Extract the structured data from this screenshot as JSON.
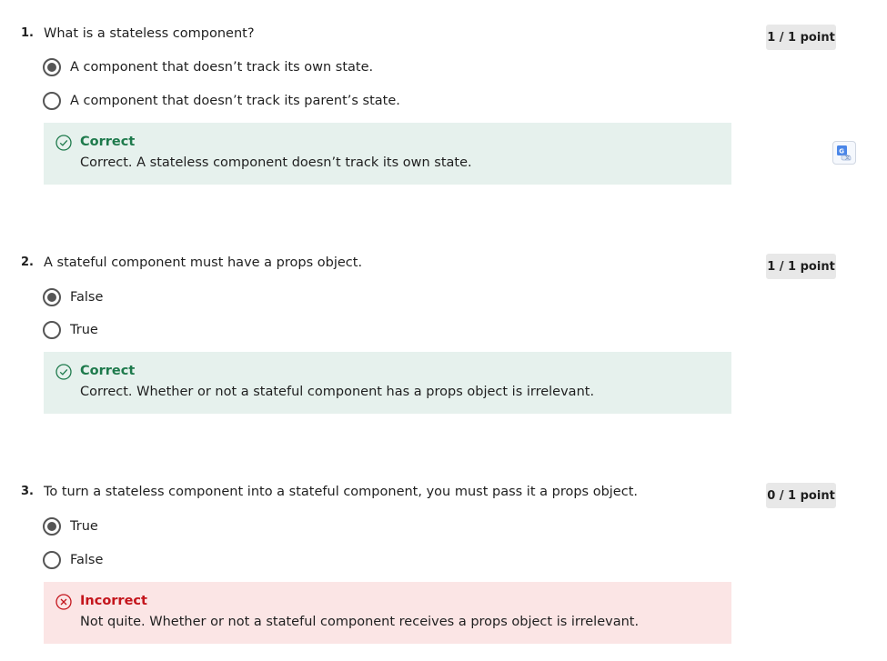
{
  "questions": [
    {
      "number": "1.",
      "text": "What is a stateless component?",
      "points": "1 / 1 point",
      "options": [
        {
          "label": "A component that doesn’t track its own state.",
          "selected": true
        },
        {
          "label": "A component that doesn’t track its parent’s state.",
          "selected": false
        }
      ],
      "feedback": {
        "status": "correct",
        "title": "Correct",
        "text": "Correct. A stateless component doesn’t track its own state."
      }
    },
    {
      "number": "2.",
      "text": "A stateful component must have a props object.",
      "points": "1 / 1 point",
      "options": [
        {
          "label": "False",
          "selected": true
        },
        {
          "label": "True",
          "selected": false
        }
      ],
      "feedback": {
        "status": "correct",
        "title": "Correct",
        "text": "Correct. Whether or not a stateful component has a props object is irrelevant."
      }
    },
    {
      "number": "3.",
      "text": "To turn a stateless component into a stateful component, you must pass it a props object.",
      "points": "0 / 1 point",
      "options": [
        {
          "label": "True",
          "selected": true
        },
        {
          "label": "False",
          "selected": false
        }
      ],
      "feedback": {
        "status": "incorrect",
        "title": "Incorrect",
        "text": "Not quite. Whether or not a stateful component receives a props object is irrelevant."
      }
    }
  ],
  "icons": {
    "correct": "check-circle-icon",
    "incorrect": "x-circle-icon",
    "translate": "google-translate-icon"
  },
  "colors": {
    "correct_title": "#1e7a4c",
    "correct_bg": "#e6f1ed",
    "incorrect_title": "#c4151c",
    "incorrect_bg": "#fbe5e5",
    "badge_bg": "#e8e8e8"
  }
}
